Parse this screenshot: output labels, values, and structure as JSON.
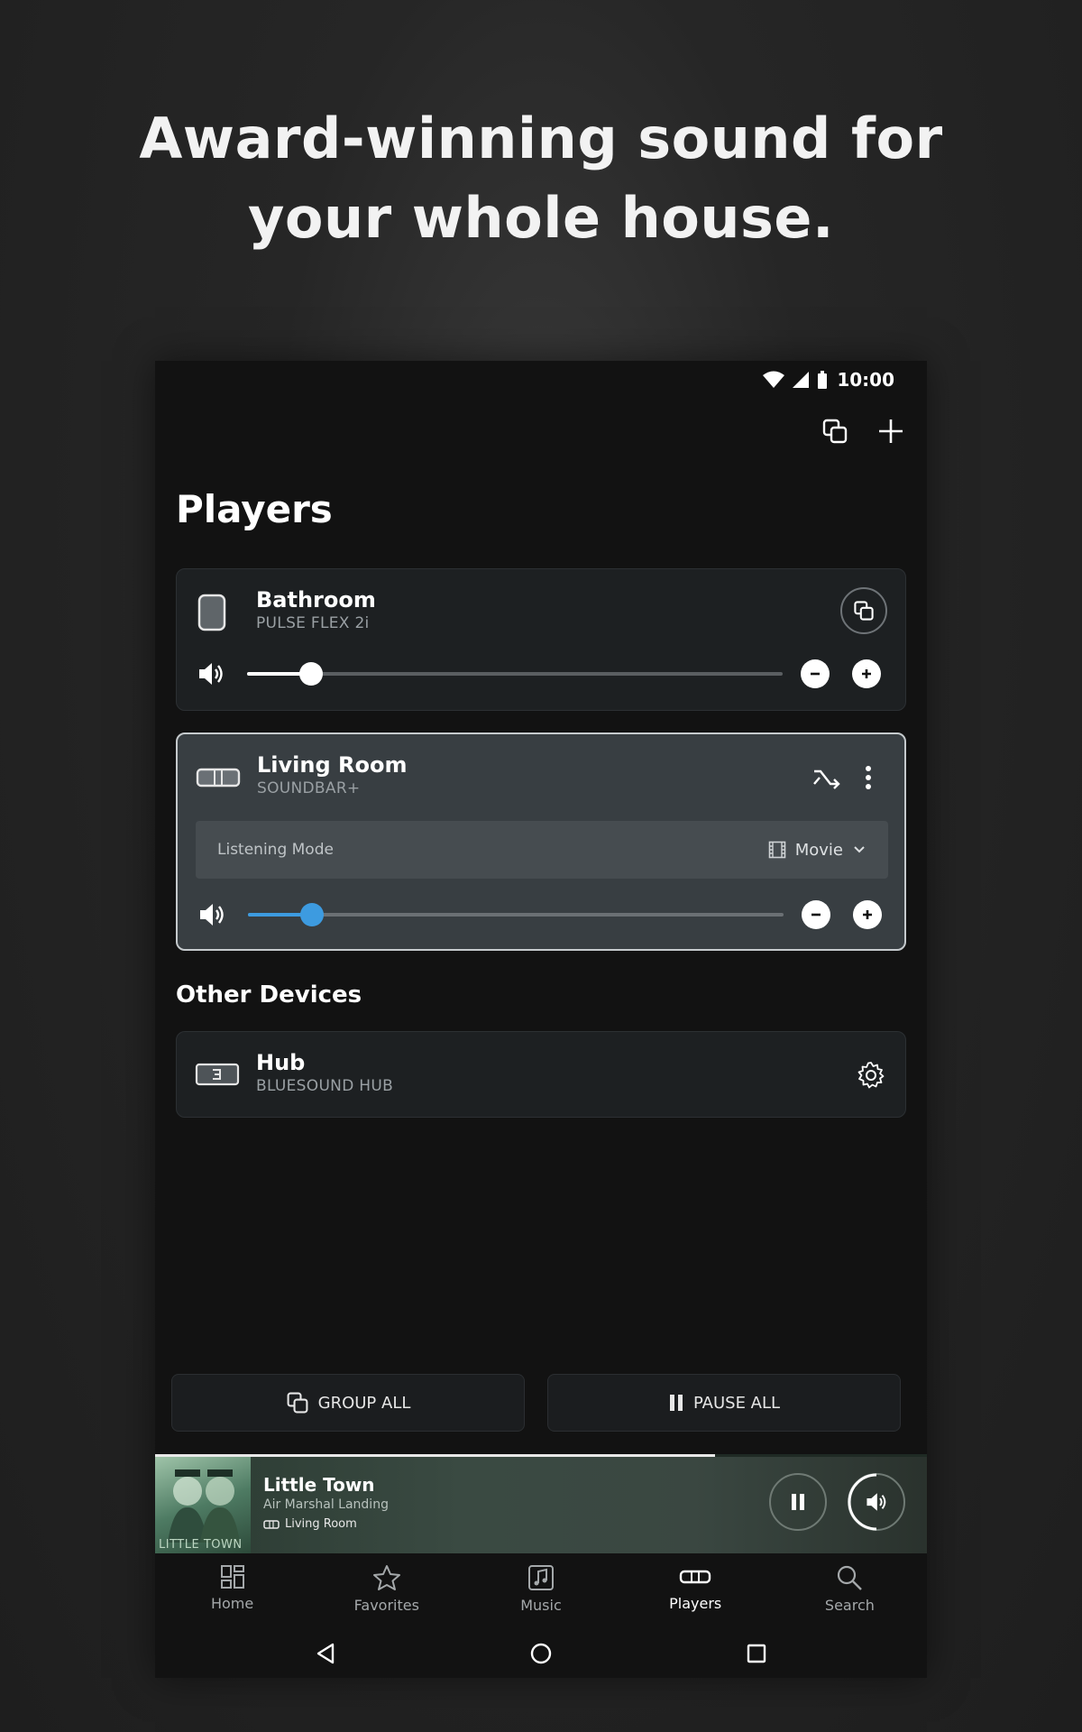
{
  "headline": {
    "line1": "Award-winning sound for",
    "line2": "your whole house."
  },
  "status": {
    "time": "10:00"
  },
  "page": {
    "title": "Players"
  },
  "players": [
    {
      "name": "Bathroom",
      "model": "PULSE FLEX 2i",
      "volume_fraction": 0.12,
      "slider_color": "#ffffff"
    },
    {
      "name": "Living Room",
      "model": "SOUNDBAR+",
      "volume_fraction": 0.12,
      "slider_color": "#3d9be0",
      "listening_mode_label": "Listening Mode",
      "listening_mode_value": "Movie"
    }
  ],
  "other_devices": {
    "label": "Other Devices",
    "items": [
      {
        "name": "Hub",
        "model": "BLUESOUND HUB"
      }
    ]
  },
  "actions": {
    "group_all": "GROUP ALL",
    "pause_all": "PAUSE ALL"
  },
  "now_playing": {
    "title": "Little Town",
    "artist": "Air Marshal Landing",
    "room": "Living Room",
    "album_art_text": "LITTLE TOWN",
    "progress_fraction": 0.725
  },
  "tabs": [
    {
      "label": "Home",
      "icon": "home-grid-icon"
    },
    {
      "label": "Favorites",
      "icon": "star-icon"
    },
    {
      "label": "Music",
      "icon": "music-note-icon"
    },
    {
      "label": "Players",
      "icon": "player-icon",
      "active": true
    },
    {
      "label": "Search",
      "icon": "search-icon"
    }
  ],
  "colors": {
    "accent": "#3d9be0",
    "background": "#121212",
    "card": "#1d2022",
    "active_card": "#383e42"
  }
}
